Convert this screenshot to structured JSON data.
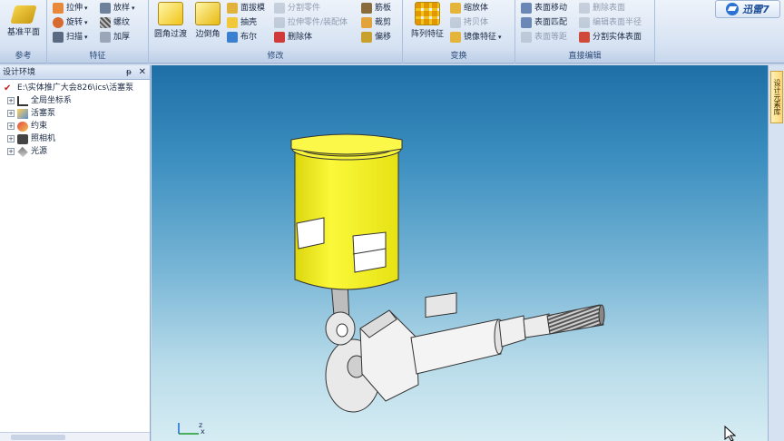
{
  "ribbon": {
    "ref_group": {
      "label": "参考",
      "big_button": "基准平面"
    },
    "feature_group": {
      "label": "特征",
      "items": [
        "拉伸",
        "旋转",
        "扫描",
        "放样",
        "螺纹",
        "加厚"
      ]
    },
    "modify_group": {
      "label": "修改",
      "big1": "圆角过渡",
      "big2": "边倒角",
      "col1": [
        "面拔模",
        "抽壳",
        "布尔"
      ],
      "col2": [
        "分割零件",
        "拉伸零件/装配体",
        "删除体"
      ],
      "col3": [
        "筋板",
        "裁剪",
        "偏移"
      ]
    },
    "transform_group": {
      "label": "变换",
      "big": "阵列特征",
      "items": [
        "缩放体",
        "拷贝体",
        "镜像特征"
      ]
    },
    "direct_group": {
      "label": "直接编辑",
      "col1": [
        "表面移动",
        "表面匹配",
        "表面等距"
      ],
      "col2": [
        "删除表面",
        "编辑表面半径",
        "分割实体表面"
      ]
    },
    "brand": "迅雷7"
  },
  "panel": {
    "title": "设计环境",
    "pin": "ᵽ",
    "close": "✕",
    "tree": [
      {
        "label": "E:\\实体推广大会826\\ics\\活塞泵",
        "expander": ""
      },
      {
        "label": "全局坐标系",
        "expander": "+"
      },
      {
        "label": "活塞泵",
        "expander": "+"
      },
      {
        "label": "约束",
        "expander": "+"
      },
      {
        "label": "照相机",
        "expander": "+"
      },
      {
        "label": "光源",
        "expander": "+"
      }
    ]
  },
  "viewport": {
    "triad": {
      "z": "z",
      "x": "x"
    }
  },
  "right_strip": {
    "tab_label": "设计元素库"
  },
  "colors": {
    "piston_cylinder": "#f2ef1d",
    "part_white": "#f2f2f2",
    "viewport_top": "#1e6fa6",
    "viewport_bottom": "#d6ecf3"
  }
}
